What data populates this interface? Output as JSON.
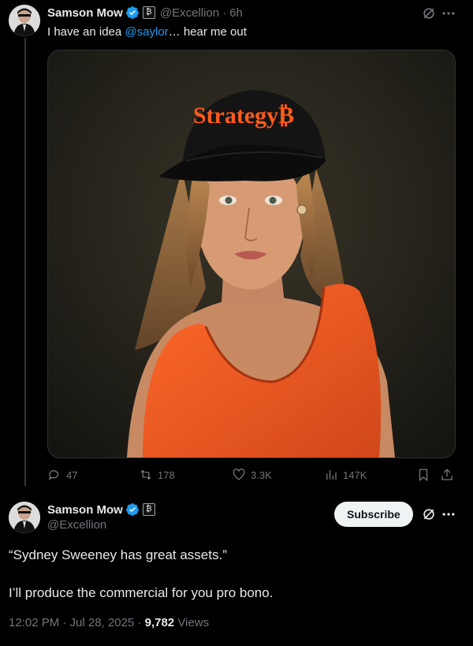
{
  "tweet": {
    "author_name": "Samson Mow",
    "handle": "@Excellion",
    "separator": "·",
    "time": "6h",
    "badge_glyph": "₿",
    "text_before": "I have an idea ",
    "mention": "@saylor",
    "text_after": "… hear me out",
    "image_caption_text": "Strategy₿",
    "actions": {
      "replies": "47",
      "reposts": "178",
      "likes": "3.3K",
      "views": "147K"
    }
  },
  "quote": {
    "author_name": "Samson Mow",
    "handle": "@Excellion",
    "badge_glyph": "₿",
    "subscribe_label": "Subscribe",
    "line1": "“Sydney Sweeney has great assets.”",
    "line2": "I’ll produce the commercial for you pro bono.",
    "time": "12:02 PM · Jul 28, 2025 · ",
    "views_count": "9,782",
    "views_label": " Views"
  },
  "colors": {
    "accent": "#1d9bf0",
    "orange": "#ff5a1a",
    "muted": "#71767b"
  },
  "icons": [
    "verified-icon",
    "grok-icon",
    "more-icon",
    "reply-icon",
    "repost-icon",
    "like-icon",
    "views-icon",
    "bookmark-icon",
    "share-icon"
  ]
}
